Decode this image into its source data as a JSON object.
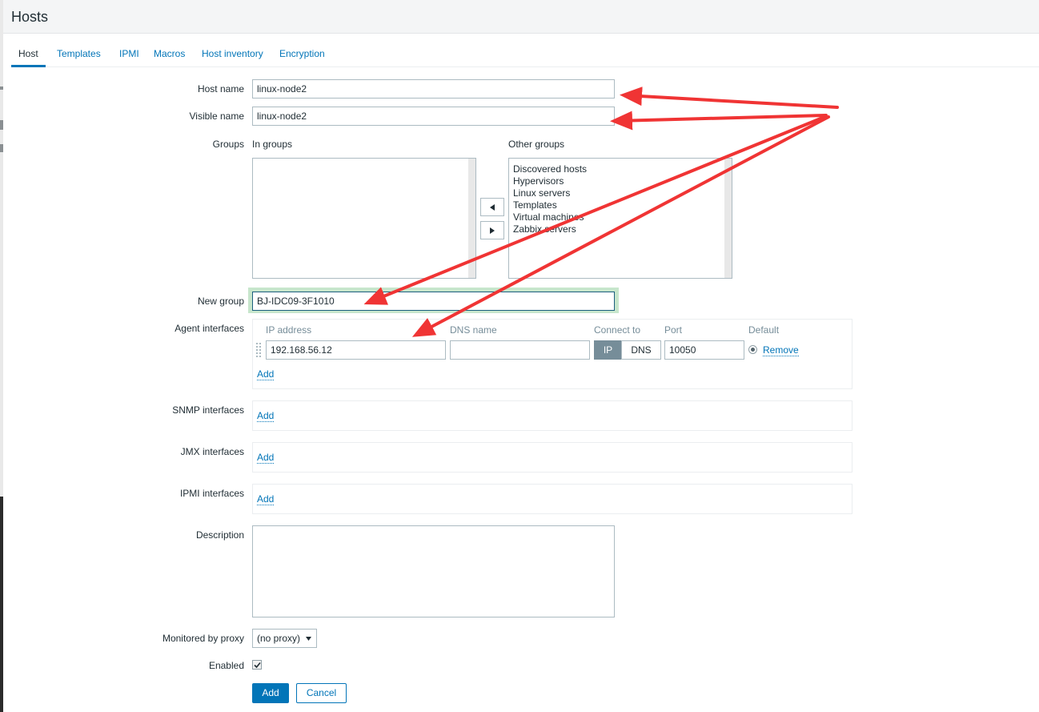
{
  "page": {
    "title": "Hosts"
  },
  "tabs": [
    {
      "label": "Host"
    },
    {
      "label": "Templates"
    },
    {
      "label": "IPMI"
    },
    {
      "label": "Macros"
    },
    {
      "label": "Host inventory"
    },
    {
      "label": "Encryption"
    }
  ],
  "form": {
    "host_name": {
      "label": "Host name",
      "value": "linux-node2"
    },
    "visible_name": {
      "label": "Visible name",
      "value": "linux-node2"
    },
    "groups": {
      "label": "Groups",
      "in_groups_label": "In groups",
      "other_groups_label": "Other groups",
      "in_groups": [],
      "other_groups": [
        "Discovered hosts",
        "Hypervisors",
        "Linux servers",
        "Templates",
        "Virtual machines",
        "Zabbix servers"
      ],
      "move_left_icon": "triangle-left-icon",
      "move_right_icon": "triangle-right-icon"
    },
    "new_group": {
      "label": "New group",
      "value": "BJ-IDC09-3F1010"
    },
    "agent_interfaces": {
      "label": "Agent interfaces",
      "headers": {
        "ip": "IP address",
        "dns": "DNS name",
        "connect_to": "Connect to",
        "port": "Port",
        "default": "Default"
      },
      "row": {
        "ip": "192.168.56.12",
        "dns": "",
        "connect_ip": "IP",
        "connect_dns": "DNS",
        "port": "10050",
        "remove": "Remove"
      },
      "add": "Add"
    },
    "snmp_interfaces": {
      "label": "SNMP interfaces",
      "add": "Add"
    },
    "jmx_interfaces": {
      "label": "JMX interfaces",
      "add": "Add"
    },
    "ipmi_interfaces": {
      "label": "IPMI interfaces",
      "add": "Add"
    },
    "description": {
      "label": "Description",
      "value": ""
    },
    "proxy": {
      "label": "Monitored by proxy",
      "selected": "(no proxy)"
    },
    "enabled": {
      "label": "Enabled",
      "checked": true
    },
    "buttons": {
      "add": "Add",
      "cancel": "Cancel"
    }
  },
  "colors": {
    "link": "#0275b8",
    "annotation_arrow": "#f03434",
    "focus_ring": "#c7e6cc",
    "segment_on": "#768d99"
  }
}
